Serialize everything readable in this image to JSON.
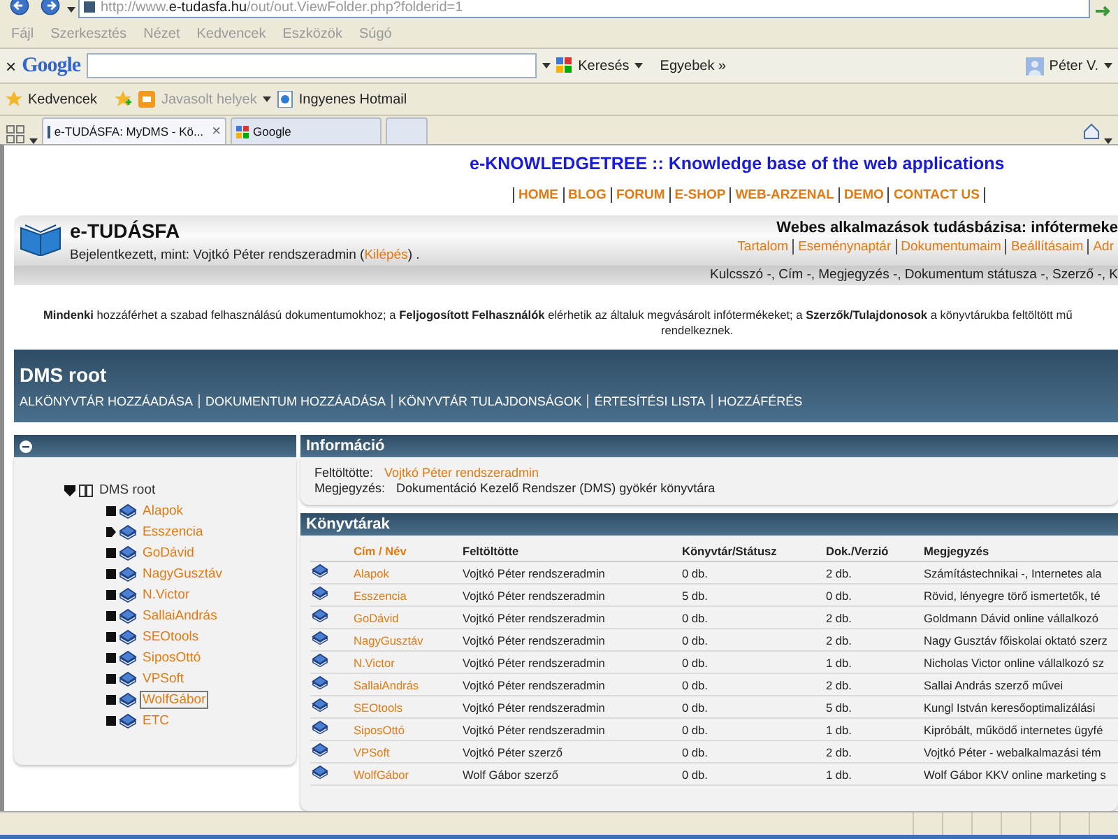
{
  "browser": {
    "address": "http://www.**e-tudasfa.hu**/out/out.ViewFolder.php?folderid=1",
    "menu": [
      "Fájl",
      "Szerkesztés",
      "Nézet",
      "Kedvencek",
      "Eszközök",
      "Súgó"
    ],
    "google_toolbar": {
      "close": "×",
      "logo": "Google",
      "search_button": "Keresés",
      "more": "Egyebek »",
      "user": "Péter V."
    },
    "favorites_bar": {
      "favorites": "Kedvencek",
      "suggested": "Javasolt helyek",
      "hotmail": "Ingyenes Hotmail"
    },
    "tabs": [
      {
        "label": "e-TUDÁSFA: MyDMS - Kö...",
        "selected": true,
        "close": "×"
      },
      {
        "label": "Google",
        "selected": false
      }
    ]
  },
  "page": {
    "site_title": "e-KNOWLEDGETREE :: Knowledge base of the web applications",
    "nav": [
      "HOME",
      "BLOG",
      "FORUM",
      "E-SHOP",
      "WEB-ARZENAL",
      "DEMO",
      "CONTACT US"
    ],
    "brand": "e-TUDÁSFA",
    "login": {
      "prefix": "Bejelentkezett, mint: Vojtkó Péter rendszeradmin (",
      "link": "Kilépés",
      "suffix": ") ."
    },
    "tagline": "Webes alkalmazások tudásbázisa: infótermeke",
    "user_links": [
      "Tartalom",
      "Eseménynaptár",
      "Dokumentumaim",
      "Beállításaim",
      "Adr"
    ],
    "search_hint": "Kulcsszó -, Cím -, Megjegyzés -, Dokumentum státusza -, Szerző -, K",
    "intro": [
      "**Mindenki** hozzáférhet a szabad felhasználású dokumentumokhoz; a **Feljogosított Felhasználók** elérhetik az általuk megvásárolt infótermékeket; a **Szerzők/Tulajdonosok** a könyvtárukba feltöltött mű",
      "rendelkeznek."
    ],
    "folder_title": "DMS root",
    "folder_actions": [
      "ALKÖNYVTÁR HOZZÁADÁSA",
      "DOKUMENTUM HOZZÁADÁSA",
      "KÖNYVTÁR TULAJDONSÁGOK",
      "ÉRTESÍTÉSI LISTA",
      "HOZZÁFÉRÉS"
    ],
    "tree": {
      "label": "DMS root",
      "expanded": true,
      "children": [
        {
          "label": "Alapok",
          "expandable": false,
          "selected": false
        },
        {
          "label": "Esszencia",
          "expandable": true,
          "selected": false
        },
        {
          "label": "GoDávid",
          "expandable": false,
          "selected": false
        },
        {
          "label": "NagyGusztáv",
          "expandable": false,
          "selected": false
        },
        {
          "label": "N.Victor",
          "expandable": false,
          "selected": false
        },
        {
          "label": "SallaiAndrás",
          "expandable": false,
          "selected": false
        },
        {
          "label": "SEOtools",
          "expandable": false,
          "selected": false
        },
        {
          "label": "SiposOttó",
          "expandable": false,
          "selected": false
        },
        {
          "label": "VPSoft",
          "expandable": false,
          "selected": false
        },
        {
          "label": "WolfGábor",
          "expandable": false,
          "selected": true
        },
        {
          "label": "ETC",
          "expandable": false,
          "selected": false
        }
      ]
    },
    "info": {
      "title": "Információ",
      "fields": [
        {
          "label": "Feltöltötte:",
          "value": "Vojtkó Péter rendszeradmin",
          "kind": "link"
        },
        {
          "label": "Megjegyzés:",
          "value": "Dokumentáció Kezelő Rendszer (DMS) gyökér könyvtára",
          "kind": "text"
        }
      ]
    },
    "folders": {
      "title": "Könyvtárak",
      "columns": [
        "Cím / Név",
        "Feltöltötte",
        "Könyvtár/Státusz",
        "Dok./Verzió",
        "Megjegyzés"
      ],
      "rows": [
        [
          "Alapok",
          "Vojtkó Péter rendszeradmin",
          "0 db.",
          "2 db.",
          "Számítástechnikai -, Internetes ala"
        ],
        [
          "Esszencia",
          "Vojtkó Péter rendszeradmin",
          "5 db.",
          "0 db.",
          "Rövid, lényegre törő ismertetők, té"
        ],
        [
          "GoDávid",
          "Vojtkó Péter rendszeradmin",
          "0 db.",
          "2 db.",
          "Goldmann Dávid online vállalkozó"
        ],
        [
          "NagyGusztáv",
          "Vojtkó Péter rendszeradmin",
          "0 db.",
          "2 db.",
          "Nagy Gusztáv főiskolai oktató szerz"
        ],
        [
          "N.Victor",
          "Vojtkó Péter rendszeradmin",
          "0 db.",
          "1 db.",
          "Nicholas Victor online vállalkozó sz"
        ],
        [
          "SallaiAndrás",
          "Vojtkó Péter rendszeradmin",
          "0 db.",
          "2 db.",
          "Sallai András szerző művei"
        ],
        [
          "SEOtools",
          "Vojtkó Péter rendszeradmin",
          "0 db.",
          "5 db.",
          "Kungl István keresőoptimalizálási"
        ],
        [
          "SiposOttó",
          "Vojtkó Péter rendszeradmin",
          "0 db.",
          "1 db.",
          "Kipróbált, működő internetes ügyfé"
        ],
        [
          "VPSoft",
          "Vojtkó Péter szerző",
          "0 db.",
          "2 db.",
          "Vojtkó Péter - webalkalmazási tém"
        ],
        [
          "WolfGábor",
          "Wolf Gábor szerző",
          "0 db.",
          "1 db.",
          "Wolf Gábor KKV online marketing s"
        ]
      ]
    }
  }
}
